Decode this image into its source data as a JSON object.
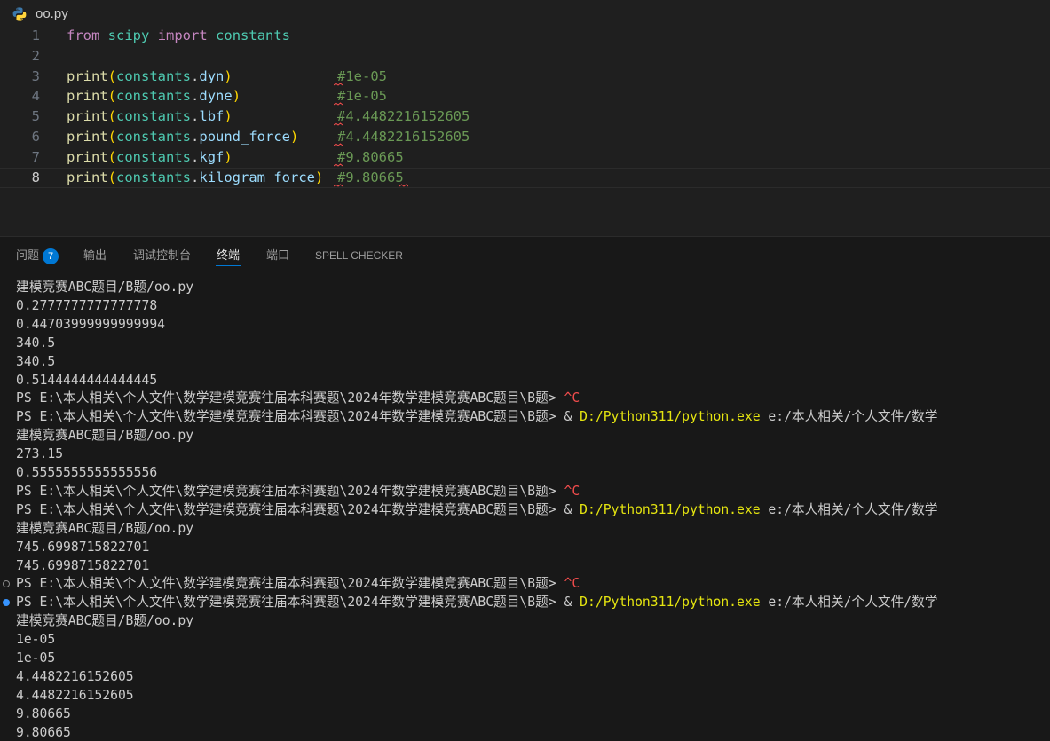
{
  "editor": {
    "file_name": "oo.py",
    "lines": [
      {
        "num": "1",
        "tokens": [
          [
            "kw",
            "from"
          ],
          [
            "sp",
            " "
          ],
          [
            "mod",
            "scipy"
          ],
          [
            "sp",
            " "
          ],
          [
            "kw",
            "import"
          ],
          [
            "sp",
            " "
          ],
          [
            "mod",
            "constants"
          ]
        ],
        "comment": ""
      },
      {
        "num": "2",
        "tokens": [],
        "comment": ""
      },
      {
        "num": "3",
        "tokens": [
          [
            "fn",
            "print"
          ],
          [
            "par",
            "("
          ],
          [
            "mod",
            "constants"
          ],
          [
            "punc",
            "."
          ],
          [
            "prop",
            "dyn"
          ],
          [
            "par",
            ")"
          ]
        ],
        "comment": "#1e-05"
      },
      {
        "num": "4",
        "tokens": [
          [
            "fn",
            "print"
          ],
          [
            "par",
            "("
          ],
          [
            "mod",
            "constants"
          ],
          [
            "punc",
            "."
          ],
          [
            "prop",
            "dyne"
          ],
          [
            "par",
            ")"
          ]
        ],
        "comment": "#1e-05"
      },
      {
        "num": "5",
        "tokens": [
          [
            "fn",
            "print"
          ],
          [
            "par",
            "("
          ],
          [
            "mod",
            "constants"
          ],
          [
            "punc",
            "."
          ],
          [
            "prop",
            "lbf"
          ],
          [
            "par",
            ")"
          ]
        ],
        "comment": "#4.4482216152605"
      },
      {
        "num": "6",
        "tokens": [
          [
            "fn",
            "print"
          ],
          [
            "par",
            "("
          ],
          [
            "mod",
            "constants"
          ],
          [
            "punc",
            "."
          ],
          [
            "prop",
            "pound_force"
          ],
          [
            "par",
            ")"
          ]
        ],
        "comment": "#4.4482216152605"
      },
      {
        "num": "7",
        "tokens": [
          [
            "fn",
            "print"
          ],
          [
            "par",
            "("
          ],
          [
            "mod",
            "constants"
          ],
          [
            "punc",
            "."
          ],
          [
            "prop",
            "kgf"
          ],
          [
            "par",
            ")"
          ]
        ],
        "comment": "#9.80665"
      },
      {
        "num": "8",
        "tokens": [
          [
            "fn",
            "print"
          ],
          [
            "par",
            "("
          ],
          [
            "mod",
            "constants"
          ],
          [
            "punc",
            "."
          ],
          [
            "prop",
            "kilogram_force"
          ],
          [
            "par",
            ")"
          ]
        ],
        "comment": "#9.80665"
      }
    ],
    "active_line": "8"
  },
  "panel": {
    "tabs": [
      {
        "label": "问题",
        "badge": "7"
      },
      {
        "label": "输出"
      },
      {
        "label": "调试控制台"
      },
      {
        "label": "终端"
      },
      {
        "label": "端口"
      },
      {
        "label": "SPELL CHECKER"
      }
    ],
    "active_tab": "终端"
  },
  "terminal": {
    "lines": [
      {
        "text": "建模竞赛ABC题目/B题/oo.py"
      },
      {
        "text": "0.2777777777777778"
      },
      {
        "text": "0.44703999999999994"
      },
      {
        "text": "340.5"
      },
      {
        "text": "340.5"
      },
      {
        "text": "0.5144444444444445"
      },
      {
        "prompt": "PS E:\\本人相关\\个人文件\\数学建模竞赛往届本科赛题\\2024年数学建模竞赛ABC题目\\B题> ",
        "ctrl": "^C"
      },
      {
        "prompt": "PS E:\\本人相关\\个人文件\\数学建模竞赛往届本科赛题\\2024年数学建模竞赛ABC题目\\B题> ",
        "amp": "& ",
        "exe": "D:/Python311/python.exe",
        "arg": " e:/本人相关/个人文件/数学"
      },
      {
        "text": "建模竞赛ABC题目/B题/oo.py"
      },
      {
        "text": "273.15"
      },
      {
        "text": "0.5555555555555556"
      },
      {
        "prompt": "PS E:\\本人相关\\个人文件\\数学建模竞赛往届本科赛题\\2024年数学建模竞赛ABC题目\\B题> ",
        "ctrl": "^C"
      },
      {
        "prompt": "PS E:\\本人相关\\个人文件\\数学建模竞赛往届本科赛题\\2024年数学建模竞赛ABC题目\\B题> ",
        "amp": "& ",
        "exe": "D:/Python311/python.exe",
        "arg": " e:/本人相关/个人文件/数学"
      },
      {
        "text": "建模竞赛ABC题目/B题/oo.py"
      },
      {
        "text": "745.6998715822701"
      },
      {
        "text": "745.6998715822701"
      },
      {
        "prompt": "PS E:\\本人相关\\个人文件\\数学建模竞赛往届本科赛题\\2024年数学建模竞赛ABC题目\\B题> ",
        "ctrl": "^C",
        "decoration": "hollow"
      },
      {
        "prompt": "PS E:\\本人相关\\个人文件\\数学建模竞赛往届本科赛题\\2024年数学建模竞赛ABC题目\\B题> ",
        "amp": "& ",
        "exe": "D:/Python311/python.exe",
        "arg": " e:/本人相关/个人文件/数学",
        "decoration": "filled"
      },
      {
        "text": "建模竞赛ABC题目/B题/oo.py"
      },
      {
        "text": "1e-05"
      },
      {
        "text": "1e-05"
      },
      {
        "text": "4.4482216152605"
      },
      {
        "text": "4.4482216152605"
      },
      {
        "text": "9.80665"
      },
      {
        "text": "9.80665"
      }
    ]
  },
  "colors": {
    "editor_bg": "#1f1f1f",
    "panel_bg": "#181818",
    "keyword": "#c586c0",
    "function": "#dcdcaa",
    "module": "#4ec9b0",
    "property": "#9cdcfe",
    "bracket": "#ffd700",
    "comment": "#6a9955",
    "accent": "#0078d4",
    "ctrl_c": "#f14c4c",
    "exe_path": "#e5e510"
  },
  "icons": {
    "file": "python-icon"
  }
}
